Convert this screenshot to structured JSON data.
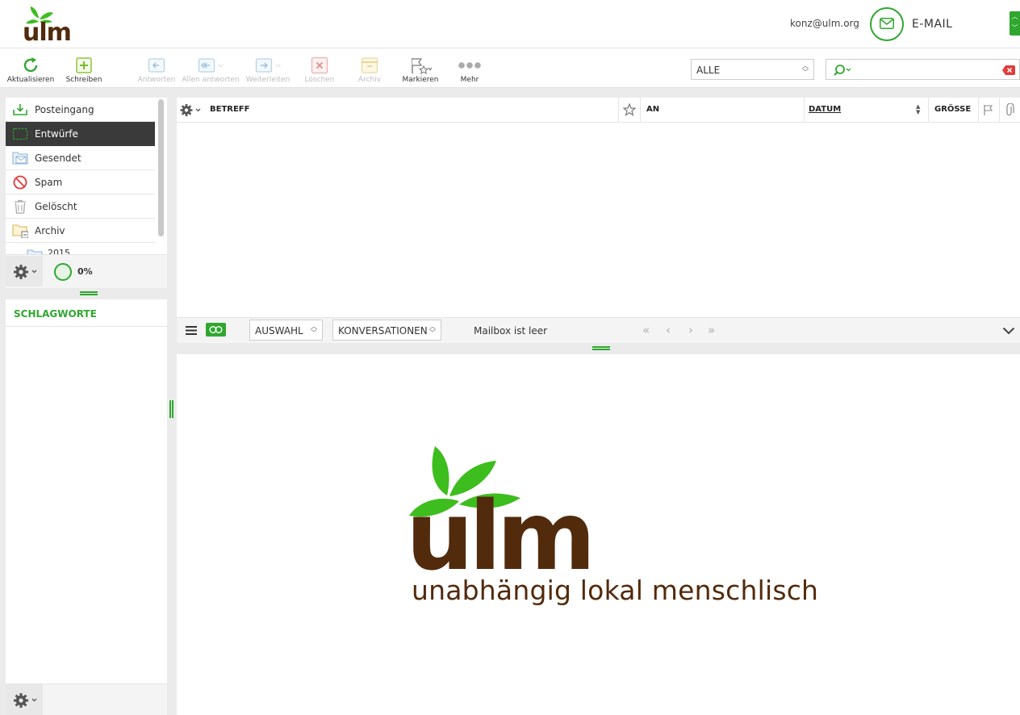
{
  "brand": {
    "logo_text": "ulm",
    "tagline": "unabhängig lokal menschlisch",
    "colors": {
      "green": "#2fa72f",
      "brown": "#522a0c",
      "leaf": "#3dbd1e"
    }
  },
  "header": {
    "account": "konz@ulm.org",
    "app_label": "E-MAIL",
    "app_icon": "envelope-icon"
  },
  "toolbar": {
    "buttons": [
      {
        "label": "Aktualisieren",
        "icon": "refresh-icon",
        "enabled": true
      },
      {
        "label": "Schreiben",
        "icon": "compose-icon",
        "enabled": true
      },
      {
        "label": "Antworten",
        "icon": "reply-icon",
        "enabled": false
      },
      {
        "label": "Allen antworten",
        "icon": "reply-all-icon",
        "enabled": false
      },
      {
        "label": "Weiterleiten",
        "icon": "forward-icon",
        "enabled": false
      },
      {
        "label": "Löschen",
        "icon": "delete-icon",
        "enabled": false
      },
      {
        "label": "Archiv",
        "icon": "archive-icon",
        "enabled": false
      },
      {
        "label": "Markieren",
        "icon": "flag-icon",
        "enabled": true
      },
      {
        "label": "Mehr",
        "icon": "more-icon",
        "enabled": true
      }
    ],
    "filter_value": "ALLE",
    "search_placeholder": ""
  },
  "folders": {
    "items": [
      {
        "label": "Posteingang",
        "icon": "inbox-icon",
        "selected": false
      },
      {
        "label": "Entwürfe",
        "icon": "drafts-icon",
        "selected": true
      },
      {
        "label": "Gesendet",
        "icon": "sent-icon",
        "selected": false
      },
      {
        "label": "Spam",
        "icon": "spam-icon",
        "selected": false
      },
      {
        "label": "Gelöscht",
        "icon": "trash-icon",
        "selected": false
      },
      {
        "label": "Archiv",
        "icon": "archive-folder-icon",
        "selected": false
      },
      {
        "label": "2015",
        "icon": "folder-icon",
        "selected": false
      }
    ],
    "quota": "0%"
  },
  "tags": {
    "title": "SCHLAGWORTE"
  },
  "list": {
    "columns": {
      "subject": "BETREFF",
      "to": "AN",
      "date": "DATUM",
      "size": "GRÖSSE"
    },
    "select_label": "AUSWAHL",
    "threads_label": "KONVERSATIONEN",
    "status": "Mailbox ist leer"
  }
}
